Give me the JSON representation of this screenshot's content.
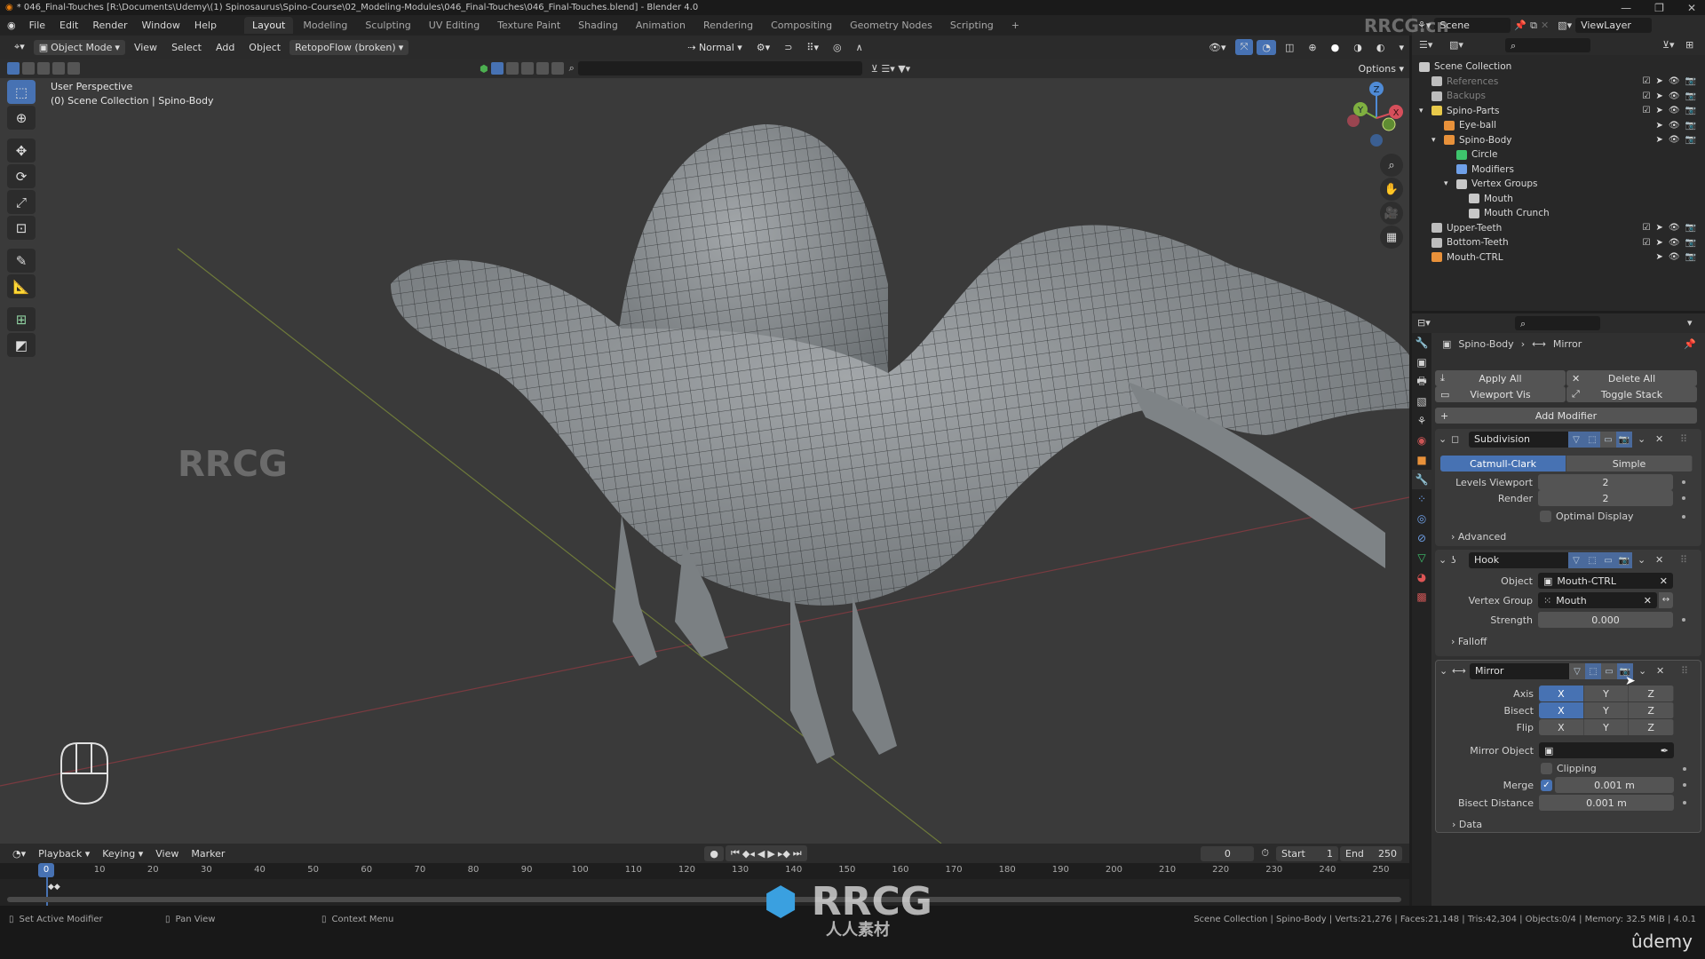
{
  "window": {
    "title": "* 046_Final-Touches [R:\\Documents\\Udemy\\(1) Spinosaurus\\Spino-Course\\02_Modeling-Modules\\046_Final-Touches\\046_Final-Touches.blend] - Blender 4.0"
  },
  "menu": {
    "items": [
      "File",
      "Edit",
      "Render",
      "Window",
      "Help"
    ],
    "workspaces": [
      "Layout",
      "Modeling",
      "Sculpting",
      "UV Editing",
      "Texture Paint",
      "Shading",
      "Animation",
      "Rendering",
      "Compositing",
      "Geometry Nodes",
      "Scripting"
    ],
    "active_workspace": "Layout",
    "add_workspace": "+"
  },
  "viewport": {
    "mode": "Object Mode",
    "menus": [
      "View",
      "Select",
      "Add",
      "Object"
    ],
    "addon_menu": "RetopoFlow (broken)",
    "orientation": "Normal",
    "options_label": "Options",
    "perspective_label": "User Perspective",
    "context_label": "(0) Scene Collection | Spino-Body",
    "gizmo_axes": [
      "Z",
      "Y",
      "X"
    ],
    "tools": [
      "select-box",
      "cursor",
      "move",
      "rotate",
      "scale",
      "transform",
      "annotate",
      "measure",
      "add-cube",
      "shear"
    ]
  },
  "timeline": {
    "menus": [
      "Playback",
      "Keying",
      "View",
      "Marker"
    ],
    "current_frame": "0",
    "start_label": "Start",
    "start": "1",
    "end_label": "End",
    "end": "250",
    "ticks": [
      "0",
      "10",
      "20",
      "30",
      "40",
      "50",
      "60",
      "70",
      "80",
      "90",
      "100",
      "110",
      "120",
      "130",
      "140",
      "150",
      "160",
      "170",
      "180",
      "190",
      "200",
      "210",
      "220",
      "230",
      "240",
      "250"
    ]
  },
  "statusbar": {
    "hints": [
      "Set Active Modifier",
      "Pan View",
      "Context Menu"
    ],
    "stats": "Scene Collection | Spino-Body | Verts:21,276 | Faces:21,148 | Tris:42,304 | Objects:0/4 | Memory: 32.5 MiB | 4.0.1",
    "brand": "ûdemy"
  },
  "outliner": {
    "scene": "Scene",
    "view_layer": "ViewLayer",
    "rows": [
      {
        "label": "Scene Collection",
        "type": "scene-collection",
        "depth": 0,
        "dim": false
      },
      {
        "label": "References",
        "type": "collection",
        "depth": 1,
        "dim": true
      },
      {
        "label": "Backups",
        "type": "collection",
        "depth": 1,
        "dim": true
      },
      {
        "label": "Spino-Parts",
        "type": "collection-yellow",
        "depth": 1,
        "dim": false,
        "expanded": true
      },
      {
        "label": "Eye-ball",
        "type": "mesh-object",
        "depth": 2,
        "dim": false
      },
      {
        "label": "Spino-Body",
        "type": "mesh-object",
        "depth": 2,
        "dim": false,
        "expanded": true
      },
      {
        "label": "Circle",
        "type": "mesh-data",
        "depth": 3,
        "dim": false
      },
      {
        "label": "Modifiers",
        "type": "modifiers",
        "depth": 3,
        "dim": false
      },
      {
        "label": "Vertex Groups",
        "type": "vertex-groups",
        "depth": 3,
        "dim": false,
        "expanded": true
      },
      {
        "label": "Mouth",
        "type": "vertex-group",
        "depth": 4,
        "dim": false
      },
      {
        "label": "Mouth Crunch",
        "type": "vertex-group",
        "depth": 4,
        "dim": false
      },
      {
        "label": "Upper-Teeth",
        "type": "collection",
        "depth": 1,
        "dim": false
      },
      {
        "label": "Bottom-Teeth",
        "type": "collection",
        "depth": 1,
        "dim": false
      },
      {
        "label": "Mouth-CTRL",
        "type": "empty",
        "depth": 1,
        "dim": false
      }
    ]
  },
  "properties": {
    "breadcrumb_object": "Spino-Body",
    "breadcrumb_modifier": "Mirror",
    "apply_all": "Apply All",
    "delete_all": "Delete All",
    "viewport_vis": "Viewport Vis",
    "toggle_stack": "Toggle Stack",
    "add_modifier": "Add Modifier",
    "subdivision": {
      "name": "Subdivision",
      "type_a": "Catmull-Clark",
      "type_b": "Simple",
      "levels_viewport_label": "Levels Viewport",
      "levels_viewport": "2",
      "render_label": "Render",
      "render": "2",
      "optimal_display": "Optimal Display",
      "advanced": "Advanced"
    },
    "hook": {
      "name": "Hook",
      "object_label": "Object",
      "object": "Mouth-CTRL",
      "vertex_group_label": "Vertex Group",
      "vertex_group": "Mouth",
      "strength_label": "Strength",
      "strength": "0.000",
      "falloff": "Falloff"
    },
    "mirror": {
      "name": "Mirror",
      "axis_label": "Axis",
      "bisect_label": "Bisect",
      "flip_label": "Flip",
      "xyz": [
        "X",
        "Y",
        "Z"
      ],
      "mirror_object_label": "Mirror Object",
      "clipping": "Clipping",
      "merge_label": "Merge",
      "merge": "0.001 m",
      "bisect_distance_label": "Bisect Distance",
      "bisect_distance": "0.001 m",
      "data": "Data"
    }
  },
  "watermarks": {
    "top": "RRCG.cn",
    "center": "RRCG",
    "center_sub": "人人素材"
  },
  "colors": {
    "accent": "#4772b3",
    "viewport_bg": "#3a3a3a",
    "mesh": "#8e9396"
  }
}
